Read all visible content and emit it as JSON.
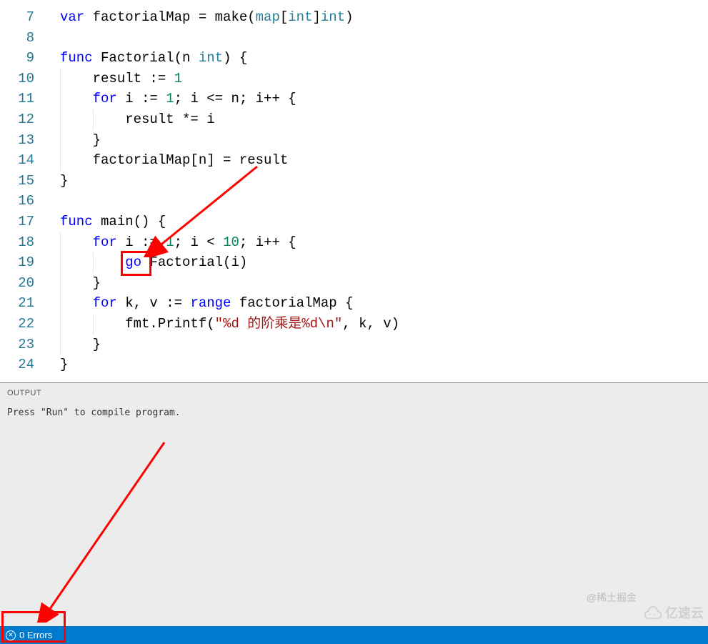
{
  "editor": {
    "lines": [
      {
        "num": 7,
        "segs": [
          {
            "t": "var ",
            "c": "tok-kw"
          },
          {
            "t": "factorialMap = make(",
            "c": "tok-ident"
          },
          {
            "t": "map",
            "c": "tok-type"
          },
          {
            "t": "[",
            "c": "tok-punct"
          },
          {
            "t": "int",
            "c": "tok-type"
          },
          {
            "t": "]",
            "c": "tok-punct"
          },
          {
            "t": "int",
            "c": "tok-type"
          },
          {
            "t": ")",
            "c": "tok-punct"
          }
        ],
        "ind": 0
      },
      {
        "num": 8,
        "segs": [],
        "ind": 0
      },
      {
        "num": 9,
        "segs": [
          {
            "t": "func ",
            "c": "tok-kw"
          },
          {
            "t": "Factorial(n ",
            "c": "tok-ident"
          },
          {
            "t": "int",
            "c": "tok-type"
          },
          {
            "t": ") {",
            "c": "tok-punct"
          }
        ],
        "ind": 0
      },
      {
        "num": 10,
        "segs": [
          {
            "t": "    result := ",
            "c": "tok-ident"
          },
          {
            "t": "1",
            "c": "tok-num"
          }
        ],
        "ind": 1
      },
      {
        "num": 11,
        "segs": [
          {
            "t": "    ",
            "c": ""
          },
          {
            "t": "for ",
            "c": "tok-kw"
          },
          {
            "t": "i := ",
            "c": "tok-ident"
          },
          {
            "t": "1",
            "c": "tok-num"
          },
          {
            "t": "; i <= n; i++ {",
            "c": "tok-ident"
          }
        ],
        "ind": 1
      },
      {
        "num": 12,
        "segs": [
          {
            "t": "        result *= i",
            "c": "tok-ident"
          }
        ],
        "ind": 2
      },
      {
        "num": 13,
        "segs": [
          {
            "t": "    }",
            "c": "tok-punct"
          }
        ],
        "ind": 1
      },
      {
        "num": 14,
        "segs": [
          {
            "t": "    factorialMap[n] = result",
            "c": "tok-ident"
          }
        ],
        "ind": 1
      },
      {
        "num": 15,
        "segs": [
          {
            "t": "}",
            "c": "tok-punct"
          }
        ],
        "ind": 0
      },
      {
        "num": 16,
        "segs": [],
        "ind": 0
      },
      {
        "num": 17,
        "segs": [
          {
            "t": "func ",
            "c": "tok-kw"
          },
          {
            "t": "main() {",
            "c": "tok-ident"
          }
        ],
        "ind": 0
      },
      {
        "num": 18,
        "segs": [
          {
            "t": "    ",
            "c": ""
          },
          {
            "t": "for ",
            "c": "tok-kw"
          },
          {
            "t": "i := ",
            "c": "tok-ident"
          },
          {
            "t": "1",
            "c": "tok-num"
          },
          {
            "t": "; i < ",
            "c": "tok-ident"
          },
          {
            "t": "10",
            "c": "tok-num"
          },
          {
            "t": "; i++ {",
            "c": "tok-ident"
          }
        ],
        "ind": 1
      },
      {
        "num": 19,
        "segs": [
          {
            "t": "        ",
            "c": ""
          },
          {
            "t": "go ",
            "c": "tok-kw"
          },
          {
            "t": "Factorial(i)",
            "c": "tok-ident"
          }
        ],
        "ind": 2
      },
      {
        "num": 20,
        "segs": [
          {
            "t": "    }",
            "c": "tok-punct"
          }
        ],
        "ind": 1
      },
      {
        "num": 21,
        "segs": [
          {
            "t": "    ",
            "c": ""
          },
          {
            "t": "for ",
            "c": "tok-kw"
          },
          {
            "t": "k, v := ",
            "c": "tok-ident"
          },
          {
            "t": "range ",
            "c": "tok-kw"
          },
          {
            "t": "factorialMap {",
            "c": "tok-ident"
          }
        ],
        "ind": 1
      },
      {
        "num": 22,
        "segs": [
          {
            "t": "        fmt.Printf(",
            "c": "tok-ident"
          },
          {
            "t": "\"%d 的阶乘是%d\\n\"",
            "c": "tok-str"
          },
          {
            "t": ", k, v)",
            "c": "tok-ident"
          }
        ],
        "ind": 2
      },
      {
        "num": 23,
        "segs": [
          {
            "t": "    }",
            "c": "tok-punct"
          }
        ],
        "ind": 1
      },
      {
        "num": 24,
        "segs": [
          {
            "t": "}",
            "c": "tok-punct"
          }
        ],
        "ind": 0
      }
    ]
  },
  "output": {
    "title": "OUTPUT",
    "message": "Press \"Run\" to compile program."
  },
  "status": {
    "errors_label": "0 Errors"
  },
  "watermarks": {
    "w1": "@稀土掘金",
    "w2": "亿速云"
  },
  "annotations": {
    "red_box_1": {
      "target": "go-keyword"
    },
    "red_box_2": {
      "target": "errors-status"
    },
    "arrow_1": {
      "from_region": "top-right",
      "to": "go-keyword"
    },
    "arrow_2": {
      "from_region": "mid-output",
      "to": "errors-status"
    }
  }
}
